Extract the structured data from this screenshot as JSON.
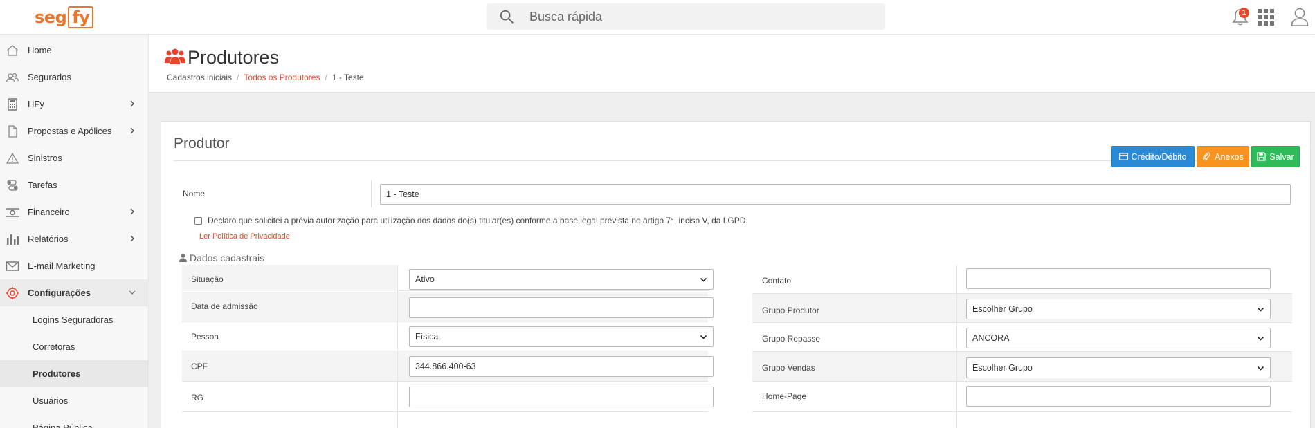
{
  "topbar": {
    "logo_left": "seg",
    "logo_right": "fy",
    "search_placeholder": "Busca rápida",
    "notification_count": "1"
  },
  "sidebar": {
    "items": [
      {
        "label": "Home",
        "icon": "home-icon"
      },
      {
        "label": "Segurados",
        "icon": "users-icon"
      },
      {
        "label": "HFy",
        "icon": "calculator-icon"
      },
      {
        "label": "Propostas e Apólices",
        "icon": "document-icon"
      },
      {
        "label": "Sinistros",
        "icon": "warning-icon"
      },
      {
        "label": "Tarefas",
        "icon": "toggles-icon"
      },
      {
        "label": "Financeiro",
        "icon": "money-icon"
      },
      {
        "label": "Relatórios",
        "icon": "bar-chart-icon"
      },
      {
        "label": "E-mail Marketing",
        "icon": "envelope-icon"
      },
      {
        "label": "Configurações",
        "icon": "gear-icon"
      }
    ],
    "subitems": [
      {
        "label": "Logins Seguradoras"
      },
      {
        "label": "Corretoras"
      },
      {
        "label": "Produtores"
      },
      {
        "label": "Usuários"
      },
      {
        "label": "Página Pública"
      }
    ]
  },
  "page": {
    "title": "Produtores",
    "breadcrumb": [
      "Cadastros iniciais",
      "Todos os Produtores",
      "1 - Teste"
    ]
  },
  "card": {
    "title": "Produtor",
    "buttons": {
      "credito": "Crédito/Débito",
      "anexos": "Anexos",
      "salvar": "Salvar"
    },
    "nome_label": "Nome",
    "nome_value": "1 - Teste",
    "declaration": "Declaro que solicitei a prévia autorização para utilização dos dados do(s) titular(es) conforme a base legal prevista no artigo 7°, inciso V, da LGPD.",
    "policy_link": "Ler Política de Privacidade",
    "section_title": "Dados cadastrais",
    "left_fields": [
      {
        "label": "Situação",
        "value": "Ativo",
        "type": "select"
      },
      {
        "label": "Data de admissão",
        "value": "",
        "type": "input"
      },
      {
        "label": "Pessoa",
        "value": "Física",
        "type": "select"
      },
      {
        "label": "CPF",
        "value": "344.866.400-63",
        "type": "input"
      },
      {
        "label": "RG",
        "value": "",
        "type": "input"
      }
    ],
    "right_fields": [
      {
        "label": "Contato",
        "value": "",
        "type": "input"
      },
      {
        "label": "Grupo Produtor",
        "value": "Escolher Grupo",
        "type": "select"
      },
      {
        "label": "Grupo Repasse",
        "value": "ANCORA",
        "type": "select"
      },
      {
        "label": "Grupo Vendas",
        "value": "Escolher Grupo",
        "type": "select"
      },
      {
        "label": "Home-Page",
        "value": "",
        "type": "input"
      }
    ]
  },
  "colors": {
    "brand": "#e8762c",
    "link": "#e8452c",
    "btn_credito": "#2b8ad6",
    "btn_anexos": "#f7931e",
    "btn_salvar": "#2ebb5a"
  }
}
